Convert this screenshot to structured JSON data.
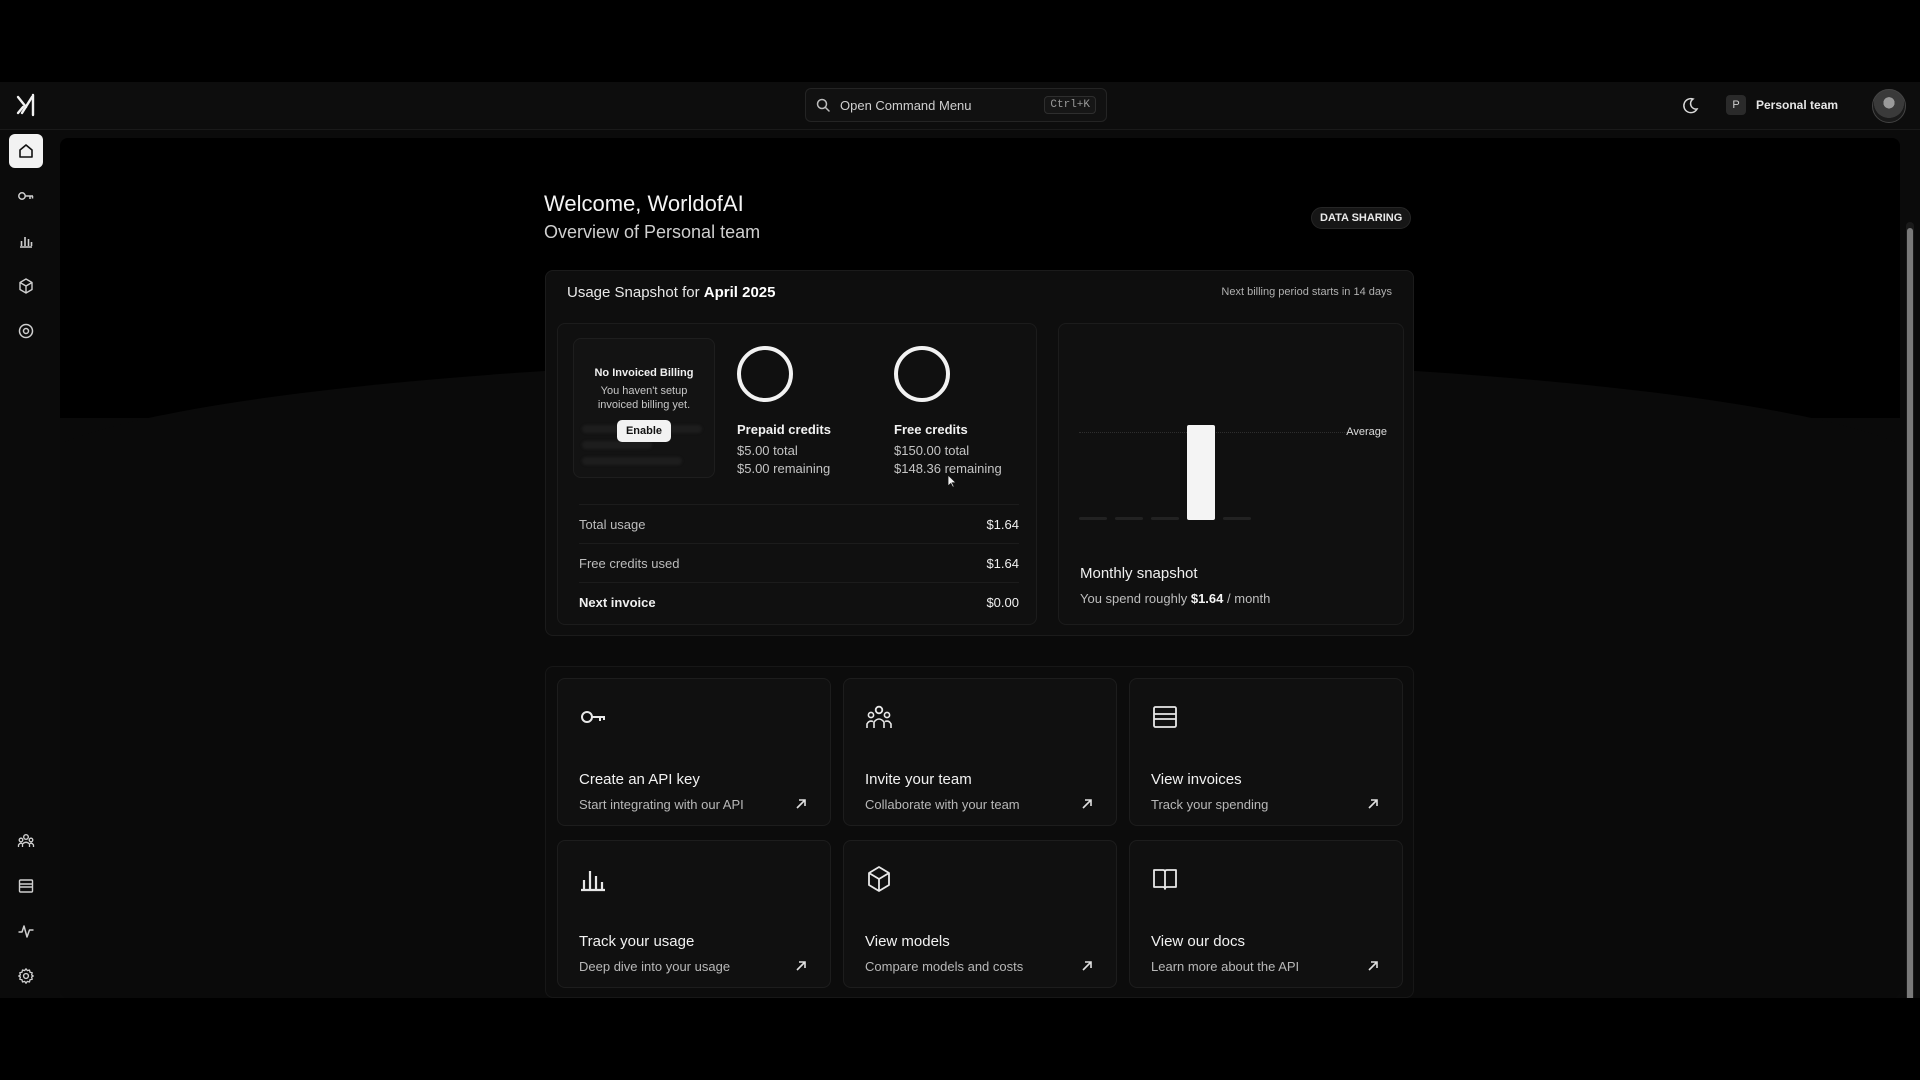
{
  "topbar": {
    "command": {
      "label": "Open Command Menu",
      "shortcut": "Ctrl+K",
      "icon": "search-icon"
    },
    "team": {
      "initial": "P",
      "name": "Personal team"
    }
  },
  "sidebar": {
    "items": [
      {
        "icon": "home-icon",
        "active": true
      },
      {
        "icon": "key-icon"
      },
      {
        "icon": "bar-chart-icon"
      },
      {
        "icon": "cube-icon"
      },
      {
        "icon": "target-icon"
      },
      {
        "icon": "team-icon"
      },
      {
        "icon": "invoice-icon"
      },
      {
        "icon": "activity-icon"
      },
      {
        "icon": "settings-icon"
      }
    ]
  },
  "header": {
    "welcome": "Welcome, WorldofAI",
    "overview": "Overview of Personal team",
    "data_sharing": "DATA SHARING"
  },
  "usage": {
    "title_prefix": "Usage Snapshot for",
    "title_month": "April 2025",
    "billing_note": "Next billing period starts in 14 days",
    "invoiced": {
      "title": "No Invoiced Billing",
      "text": "You haven't setup invoiced billing yet.",
      "button": "Enable"
    },
    "prepaid": {
      "name": "Prepaid credits",
      "total": "$5.00 total",
      "remaining": "$5.00 remaining",
      "fraction_remaining": 1.0
    },
    "free": {
      "name": "Free credits",
      "total": "$150.00 total",
      "remaining": "$148.36 remaining",
      "fraction_remaining": 0.989
    },
    "rows": [
      {
        "label": "Total usage",
        "value": "$1.64"
      },
      {
        "label": "Free credits used",
        "value": "$1.64"
      },
      {
        "label": "Next invoice",
        "value": "$0.00"
      }
    ],
    "snapshot": {
      "average_label": "Average",
      "title": "Monthly snapshot",
      "sub_prefix": "You spend roughly",
      "amount": "$1.64",
      "sub_suffix": "/ month"
    }
  },
  "chart_data": {
    "type": "bar",
    "categories": [
      "",
      "",
      "",
      "",
      ""
    ],
    "values": [
      0,
      0,
      0,
      1.64,
      0
    ],
    "average": 1.64
  },
  "actions": [
    {
      "icon": "key-icon",
      "title": "Create an API key",
      "subtitle": "Start integrating with our API"
    },
    {
      "icon": "team-icon",
      "title": "Invite your team",
      "subtitle": "Collaborate with your team"
    },
    {
      "icon": "invoice-icon",
      "title": "View invoices",
      "subtitle": "Track your spending"
    },
    {
      "icon": "bar-chart-icon",
      "title": "Track your usage",
      "subtitle": "Deep dive into your usage"
    },
    {
      "icon": "cube-icon",
      "title": "View models",
      "subtitle": "Compare models and costs"
    },
    {
      "icon": "book-icon",
      "title": "View our docs",
      "subtitle": "Learn more about the API"
    }
  ]
}
